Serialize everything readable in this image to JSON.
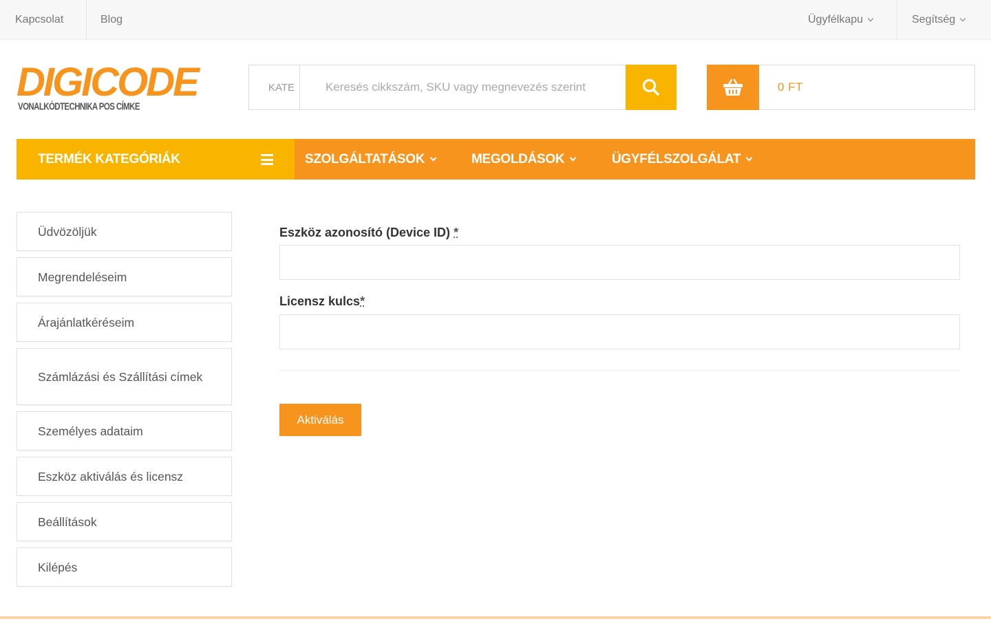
{
  "topbar": {
    "links": [
      "Kapcsolat",
      "Blog"
    ],
    "right": [
      "Ügyfélkapu",
      "Segítség"
    ]
  },
  "logo": {
    "main": "DIGICODE",
    "sub": "VONALKÓDTECHNIKA POS CÍMKE"
  },
  "search": {
    "category": "KATE",
    "placeholder": "Keresés cikkszám, SKU vagy megnevezés szerint"
  },
  "cart": {
    "amount": "0 FT"
  },
  "nav": {
    "categories": "TERMÉK KATEGÓRIÁK",
    "items": [
      "SZOLGÁLTATÁSOK",
      "MEGOLDÁSOK",
      "ÜGYFÉLSZOLGÁLAT"
    ]
  },
  "sidebar": {
    "items": [
      "Üdvözöljük",
      "Megrendeléseim",
      "Árajánlatkéréseim",
      "Számlázási és Szállítási címek",
      "Személyes adataim",
      "Eszköz aktiválás és licensz",
      "Beállítások",
      "Kilépés"
    ]
  },
  "form": {
    "device_label": "Eszköz azonosító (Device ID) ",
    "license_label": "Licensz kulcs",
    "required_mark": "*",
    "device_value": "",
    "license_value": "",
    "submit": "Aktiválás"
  },
  "colors": {
    "accent_orange": "#f7941d",
    "accent_yellow": "#f9b400"
  }
}
